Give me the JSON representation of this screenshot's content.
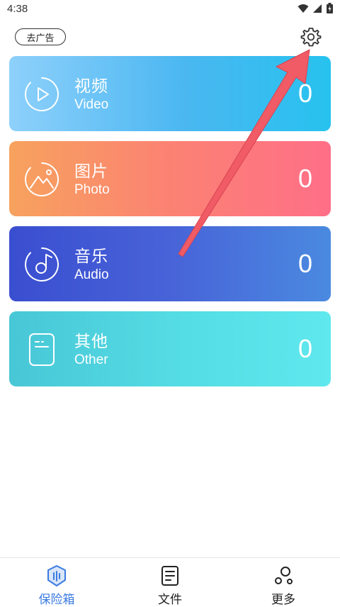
{
  "status_bar": {
    "time": "4:38",
    "icons": [
      "wifi-icon",
      "signal-icon",
      "battery-icon"
    ]
  },
  "header": {
    "ad_label": "去广告",
    "settings_icon": "gear-icon"
  },
  "categories": [
    {
      "title": "视频",
      "subtitle": "Video",
      "count": "0",
      "icon": "video-play-icon"
    },
    {
      "title": "图片",
      "subtitle": "Photo",
      "count": "0",
      "icon": "photo-mountain-icon"
    },
    {
      "title": "音乐",
      "subtitle": "Audio",
      "count": "0",
      "icon": "music-note-icon"
    },
    {
      "title": "其他",
      "subtitle": "Other",
      "count": "0",
      "icon": "file-icon"
    }
  ],
  "bottom_nav": [
    {
      "label": "保险箱",
      "icon": "vault-icon",
      "active": true
    },
    {
      "label": "文件",
      "icon": "document-icon",
      "active": false
    },
    {
      "label": "更多",
      "icon": "more-nodes-icon",
      "active": false
    }
  ],
  "colors": {
    "active_tab": "#3a7be0",
    "annotation_arrow": "#f05b66"
  }
}
